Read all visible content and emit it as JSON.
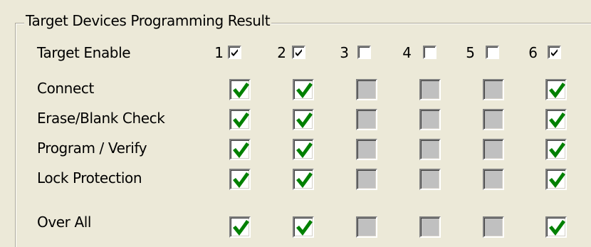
{
  "group_title": "Target Devices Programming Result",
  "rows": {
    "target_enable": "Target Enable",
    "connect": "Connect",
    "erase_blank_check": "Erase/Blank Check",
    "program_verify": "Program / Verify",
    "lock_protection": "Lock Protection",
    "over_all": "Over All"
  },
  "targets": [
    {
      "number": "1",
      "enabled": true
    },
    {
      "number": "2",
      "enabled": true
    },
    {
      "number": "3",
      "enabled": false
    },
    {
      "number": "4",
      "enabled": false
    },
    {
      "number": "5",
      "enabled": false
    },
    {
      "number": "6",
      "enabled": true
    }
  ],
  "results": {
    "connect": [
      "pass",
      "pass",
      "none",
      "none",
      "none",
      "pass"
    ],
    "erase_blank_check": [
      "pass",
      "pass",
      "none",
      "none",
      "none",
      "pass"
    ],
    "program_verify": [
      "pass",
      "pass",
      "none",
      "none",
      "none",
      "pass"
    ],
    "lock_protection": [
      "pass",
      "pass",
      "none",
      "none",
      "none",
      "pass"
    ],
    "over_all": [
      "pass",
      "pass",
      "none",
      "none",
      "none",
      "pass"
    ]
  },
  "colors": {
    "pass_check": "#008000",
    "inactive_fill": "#c0c0c0",
    "panel_bg": "#ece9d8"
  },
  "icons": {
    "pass": "green-check-icon",
    "enable": "black-check-icon"
  }
}
